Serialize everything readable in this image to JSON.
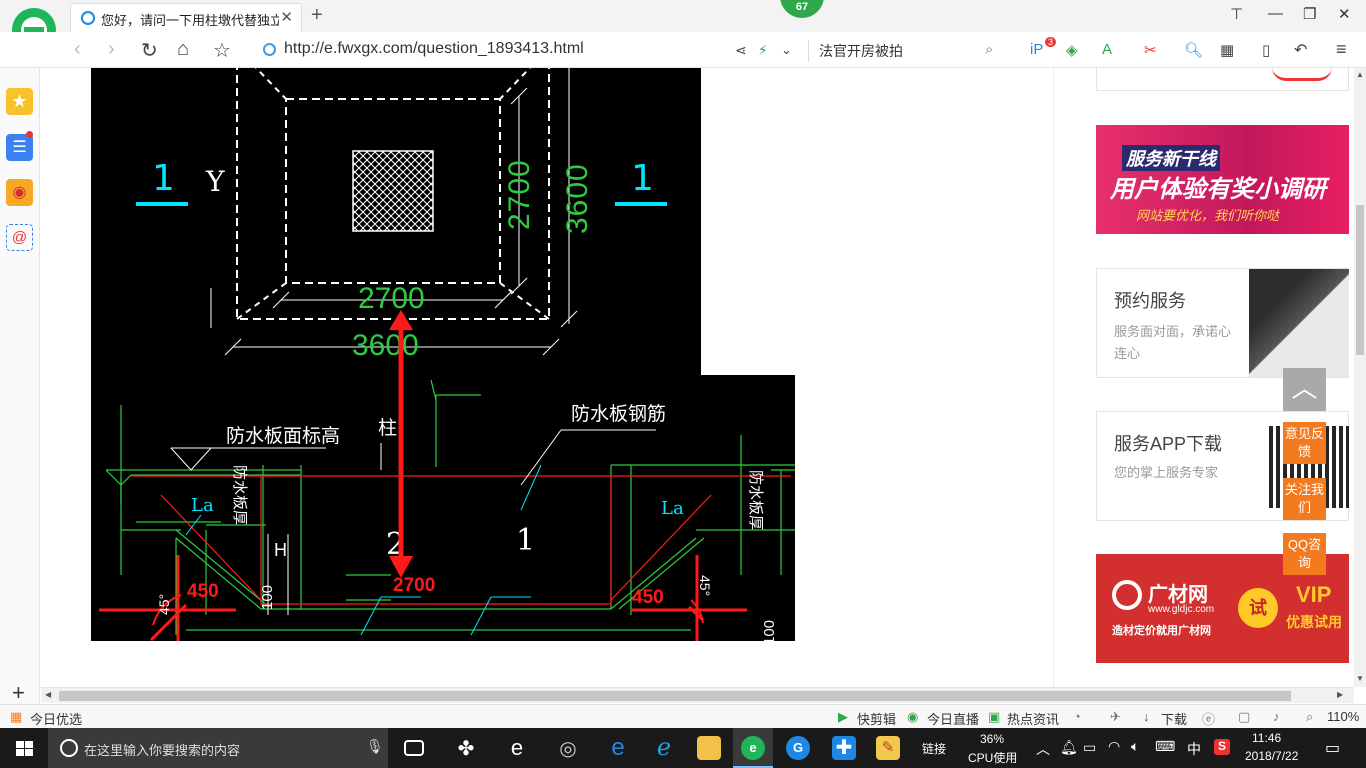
{
  "browser": {
    "tab_title": "您好，请问一下用柱墩代替独立基",
    "badge_count": "67",
    "url": "http://e.fwxgx.com/question_1893413.html",
    "search_text": "法官开房被拍",
    "ext_badge": "3"
  },
  "cad": {
    "section_left": "1",
    "section_right": "1",
    "y_label": "Y",
    "dim_inner_v": "2700",
    "dim_outer_v": "3600",
    "dim_inner_h": "2700",
    "dim_outer_h": "3600",
    "label_waterproof_top": "防水板面标高",
    "label_column": "柱",
    "label_rebar": "防水板钢筋",
    "label_board_thk_left": "防水板厚",
    "label_board_thk_right": "防水板厚",
    "la_left": "La",
    "la_right": "La",
    "h_label": "H",
    "dim_100_left": "100",
    "dim_100_right": "100",
    "num_2": "2",
    "num_1": "1",
    "angle_left": "45°",
    "angle_right": "45°",
    "red_450_left": "450",
    "red_450_right": "450",
    "red_2700": "2700"
  },
  "sidebar_cards": [
    {
      "title": "服务新干线",
      "line": "用户体验有奖小调研",
      "sub": "网站要优化，我们听你哒"
    },
    {
      "title": "预约服务",
      "sub": "服务面对面，承诺心连心"
    },
    {
      "title": "服务APP下载",
      "sub": "您的掌上服务专家"
    },
    {
      "title": "广材网",
      "url": "www.gldjc.com",
      "slogan": "造材定价就用广材网",
      "try": "试",
      "vip": "VIP",
      "vip_sub": "优惠试用"
    }
  ],
  "float_buttons": {
    "feedback": "意见反馈",
    "follow": "关注我们",
    "qq": "QQ咨询"
  },
  "statusbar": {
    "left": "今日优选",
    "kuaijianji": "快剪辑",
    "live": "今日直播",
    "news": "热点资讯",
    "download": "下载",
    "zoom": "110%"
  },
  "taskbar": {
    "search_placeholder": "在这里输入你要搜索的内容",
    "link": "链接",
    "cpu_pct": "36%",
    "cpu_label": "CPU使用",
    "ime": "中",
    "time": "11:46",
    "date": "2018/7/22"
  },
  "colors": {
    "cad_green": "#2ecc40",
    "cad_white": "#ffffff",
    "cad_cyan": "#00e5ff",
    "cad_red": "#ff1a1a",
    "accent_orange": "#f47a20",
    "ad_pink": "#e8306d"
  }
}
